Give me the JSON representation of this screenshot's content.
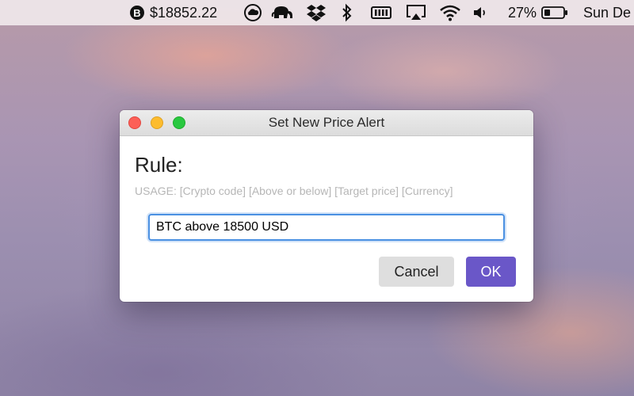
{
  "menubar": {
    "btc_symbol": "B",
    "btc_price": "$18852.22",
    "battery_percent": "27%",
    "clock": "Sun De",
    "icons": [
      "bitcoin-icon",
      "cloud-icon",
      "elephant-icon",
      "dropbox-icon",
      "bluetooth-icon",
      "memory-icon",
      "airplay-icon",
      "wifi-icon",
      "volume-icon",
      "battery-icon"
    ]
  },
  "dialog": {
    "title": "Set New Price Alert",
    "rule_label": "Rule:",
    "usage": "USAGE: [Crypto code] [Above or below] [Target price] [Currency]",
    "input_value": "BTC above 18500 USD",
    "cancel_label": "Cancel",
    "ok_label": "OK",
    "accent_color": "#6a57c8",
    "focus_color": "#4a90e2"
  }
}
